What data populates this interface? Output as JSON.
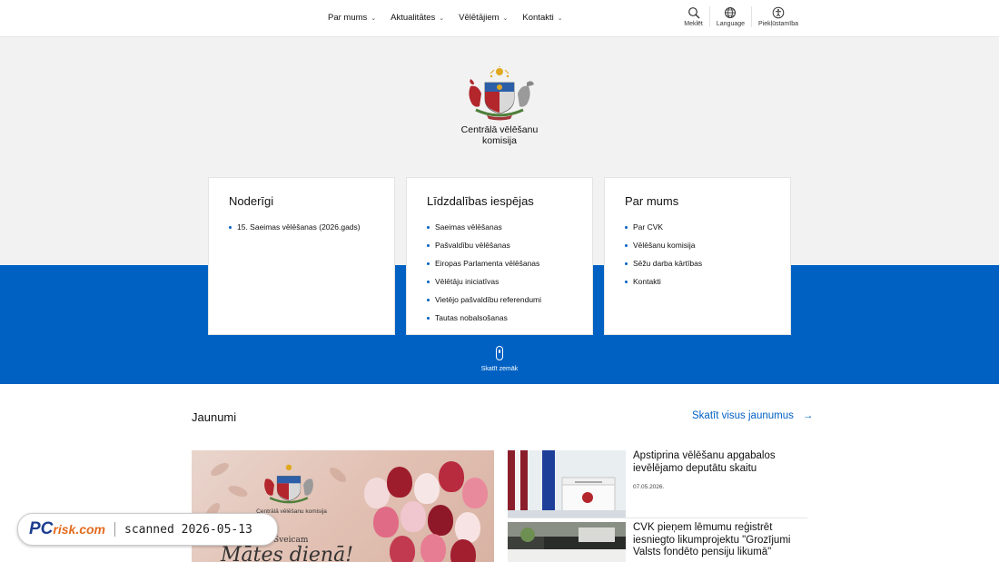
{
  "nav": {
    "items": [
      {
        "label": "Par mums"
      },
      {
        "label": "Aktualitātes"
      },
      {
        "label": "Vēlētājiem"
      },
      {
        "label": "Kontakti"
      }
    ]
  },
  "tools": {
    "search": "Meklēt",
    "language": "Language",
    "accessibility": "Piekļūstamība"
  },
  "hero": {
    "org_name": "Centrālā vēlēšanu komisija",
    "scroll_hint": "Skatīt zemāk"
  },
  "cards": [
    {
      "title": "Noderīgi",
      "links": [
        "15. Saeimas vēlēšanas (2026.gads)"
      ]
    },
    {
      "title": "Līdzdalības iespējas",
      "links": [
        "Saeimas vēlēšanas",
        "Pašvaldību vēlēšanas",
        "Eiropas Parlamenta vēlēšanas",
        "Vēlētāju iniciatīvas",
        "Vietējo pašvaldību referendumi",
        "Tautas nobalsošanas"
      ]
    },
    {
      "title": "Par mums",
      "links": [
        "Par CVK",
        "Vēlēšanu komisija",
        "Sēžu darba kārtības",
        "Kontakti"
      ]
    }
  ],
  "news": {
    "title": "Jaunumi",
    "view_all": "Skatīt visus jaunumus",
    "feature": {
      "org_name": "Centrālā vēlēšanu komisija",
      "greeting": "Sveicam",
      "script": "Mātes dienā!"
    },
    "items": [
      {
        "headline": "Apstiprina vēlēšanu apgabalos ievēlējamo deputātu skaitu",
        "date": "07.05.2026."
      },
      {
        "headline": "CVK pieņem lēmumu reģistrēt iesniegto likumprojektu \"Grozījumi Valsts fondēto pensiju likumā\"",
        "date": ""
      }
    ]
  },
  "watermark": {
    "brand_pc": "PC",
    "brand_risk": "risk.com",
    "text": "scanned 2026-05-13"
  },
  "colors": {
    "accent": "#0061c3",
    "grey_bg": "#f2f2f2"
  }
}
